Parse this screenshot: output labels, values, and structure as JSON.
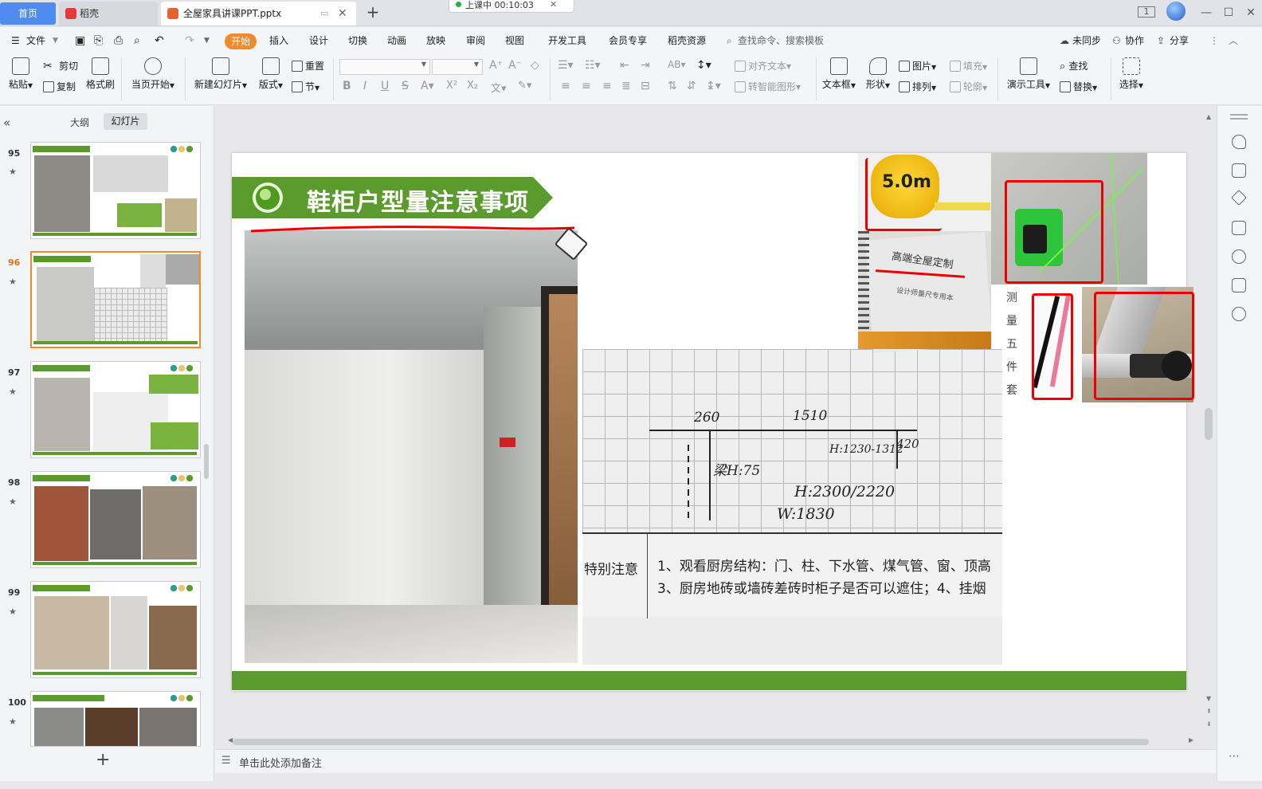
{
  "tabs": {
    "home": "首页",
    "daoke": "稻壳",
    "doc": "全屋家具讲课PPT.pptx",
    "add": "+"
  },
  "timer": "上课中 00:10:03",
  "menu": {
    "file": "文件",
    "items": [
      "开始",
      "插入",
      "设计",
      "切换",
      "动画",
      "放映",
      "审阅",
      "视图",
      "开发工具",
      "会员专享",
      "稻壳资源"
    ],
    "search": "查找命令、搜索模板",
    "sync": "未同步",
    "collab": "协作",
    "share": "分享"
  },
  "ribbon": {
    "paste": "粘贴",
    "cut": "剪切",
    "copy": "复制",
    "format_painter": "格式刷",
    "from_current": "当页开始",
    "new_slide": "新建幻灯片",
    "layout": "版式",
    "reset": "重置",
    "section": "节",
    "align_text": "对齐文本",
    "smart_art": "转智能图形",
    "textbox": "文本框",
    "shape": "形状",
    "picture": "图片",
    "arrange": "排列",
    "fill": "填充",
    "outline": "轮廓",
    "present_tools": "演示工具",
    "find": "查找",
    "replace": "替换",
    "select": "选择"
  },
  "panel": {
    "outline_tab": "大纲",
    "slides_tab": "幻灯片",
    "add": "+",
    "thumbs": [
      {
        "num": "95"
      },
      {
        "num": "96"
      },
      {
        "num": "97"
      },
      {
        "num": "98"
      },
      {
        "num": "99"
      },
      {
        "num": "100"
      }
    ]
  },
  "slide": {
    "title": "鞋柜户型量注意事项",
    "vertical_text": "测量五件套",
    "sketch": {
      "n1": "260",
      "n2": "1510",
      "n3": "H:1230-1312",
      "n4": "420",
      "n5": "梁H:75",
      "n6": "H:2300/2220",
      "n7": "W:1830",
      "note_label": "特别注意",
      "line1": "1、观看厨房结构：门、柱、下水管、煤气管、窗、顶高",
      "line2": "3、厨房地砖或墙砖差砖时柜子是否可以遮住；4、挂烟"
    },
    "tape_label": "5.0m",
    "book_title": "高端全屋定制",
    "book_sub": "设计师量尺专用本"
  },
  "notes_placeholder": "单击此处添加备注",
  "colors": {
    "accent": "#f08a2a",
    "green": "#5b9a2c",
    "home_tab": "#4e8cf2"
  }
}
